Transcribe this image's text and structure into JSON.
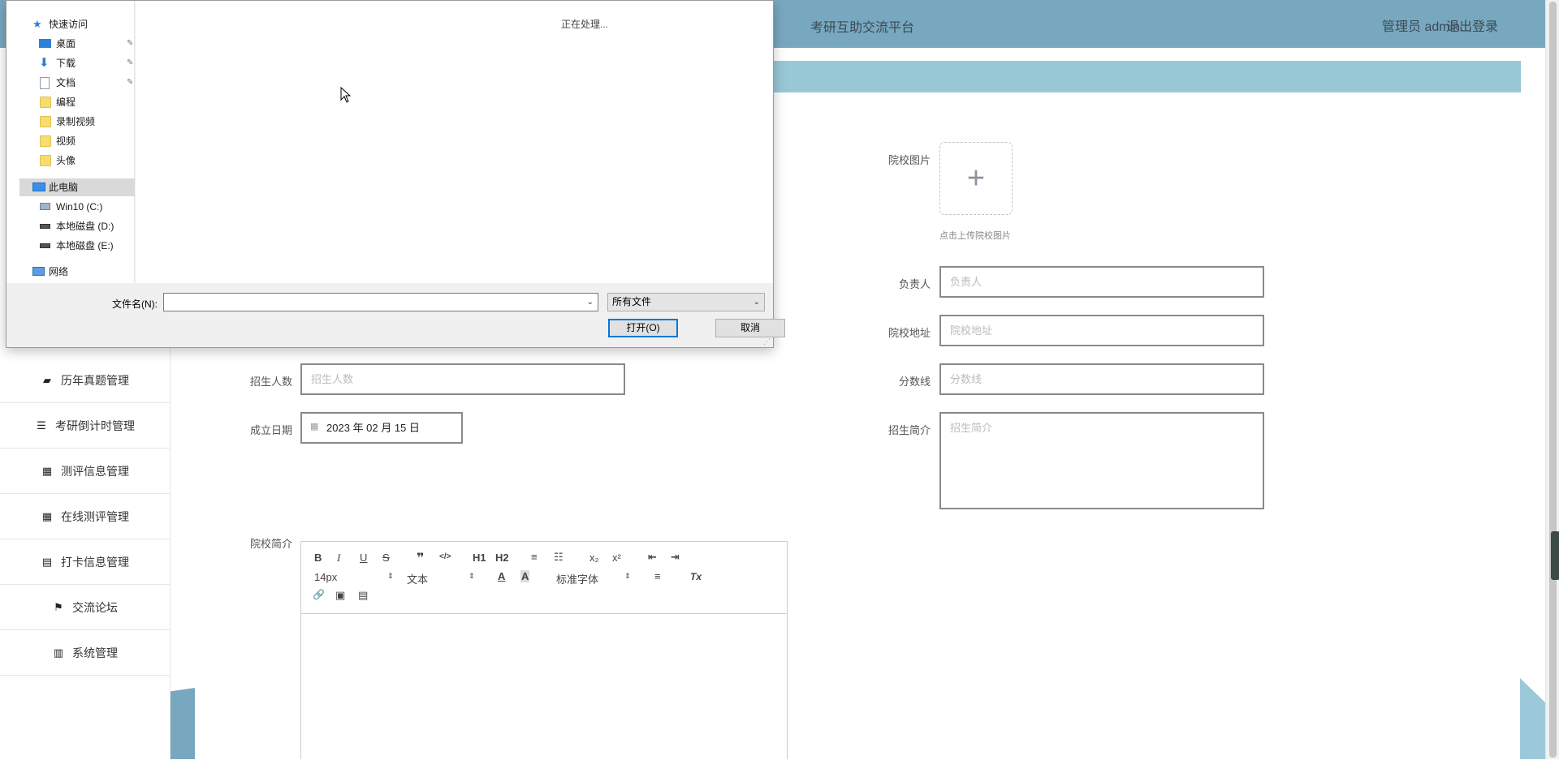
{
  "header": {
    "title": "考研互助交流平台",
    "user": "管理员 admin",
    "logout": "退出登录"
  },
  "sidebar": {
    "items": [
      {
        "icon": "wallet-icon",
        "glyph": "▰",
        "label": "历年真题管理"
      },
      {
        "icon": "list-icon",
        "glyph": "☰",
        "label": "考研倒计时管理"
      },
      {
        "icon": "grid-icon",
        "glyph": "▦",
        "label": "测评信息管理"
      },
      {
        "icon": "grid-icon",
        "glyph": "▦",
        "label": "在线测评管理"
      },
      {
        "icon": "clipboard-icon",
        "glyph": "▤",
        "label": "打卡信息管理"
      },
      {
        "icon": "flag-icon",
        "glyph": "⚑",
        "label": "交流论坛"
      },
      {
        "icon": "book-icon",
        "glyph": "▥",
        "label": "系统管理"
      }
    ]
  },
  "form": {
    "school_image": {
      "label": "院校图片",
      "tip": "点击上传院校图片",
      "plus": "+"
    },
    "manager": {
      "label": "负责人",
      "placeholder": "负责人"
    },
    "address": {
      "label": "院校地址",
      "placeholder": "院校地址"
    },
    "score_line": {
      "label": "分数线",
      "placeholder": "分数线"
    },
    "enrollment": {
      "label": "招生人数",
      "placeholder": "招生人数"
    },
    "found_date": {
      "label": "成立日期",
      "value": "2023 年 02 月 15 日"
    },
    "recruit_intro": {
      "label": "招生简介",
      "placeholder": "招生简介"
    },
    "school_intro": {
      "label": "院校简介"
    }
  },
  "editor": {
    "font_size": "14px",
    "block_type": "文本",
    "font_family": "标准字体",
    "buttons": [
      "B",
      "I",
      "U",
      "S",
      "❞",
      "</>",
      "H1",
      "H2",
      "≡",
      "☷",
      "x₂",
      "x²",
      "⇤",
      "⇥",
      "A",
      "A",
      "≡",
      "Tx",
      "🔗",
      "▣",
      "▤"
    ]
  },
  "dialog": {
    "processing": "正在处理...",
    "quick_access": "快速访问",
    "nav": [
      {
        "label": "桌面",
        "icon": "desktop-icon",
        "pinned": true
      },
      {
        "label": "下载",
        "icon": "download-icon",
        "pinned": true
      },
      {
        "label": "文档",
        "icon": "document-icon",
        "pinned": true
      },
      {
        "label": "编程",
        "icon": "folder-icon",
        "pinned": false
      },
      {
        "label": "录制视频",
        "icon": "folder-icon",
        "pinned": false
      },
      {
        "label": "视频",
        "icon": "folder-icon",
        "pinned": false
      },
      {
        "label": "头像",
        "icon": "folder-icon",
        "pinned": false
      }
    ],
    "this_pc": "此电脑",
    "drives": [
      "Win10 (C:)",
      "本地磁盘 (D:)",
      "本地磁盘 (E:)"
    ],
    "network": "网络",
    "filename_label": "文件名(N):",
    "filename_value": "",
    "filetype": "所有文件",
    "open": "打开(O)",
    "cancel": "取消"
  },
  "colors": {
    "header": "#78a8bf",
    "subbar": "#98c8d6",
    "dialog_accent": "#0078d7"
  }
}
